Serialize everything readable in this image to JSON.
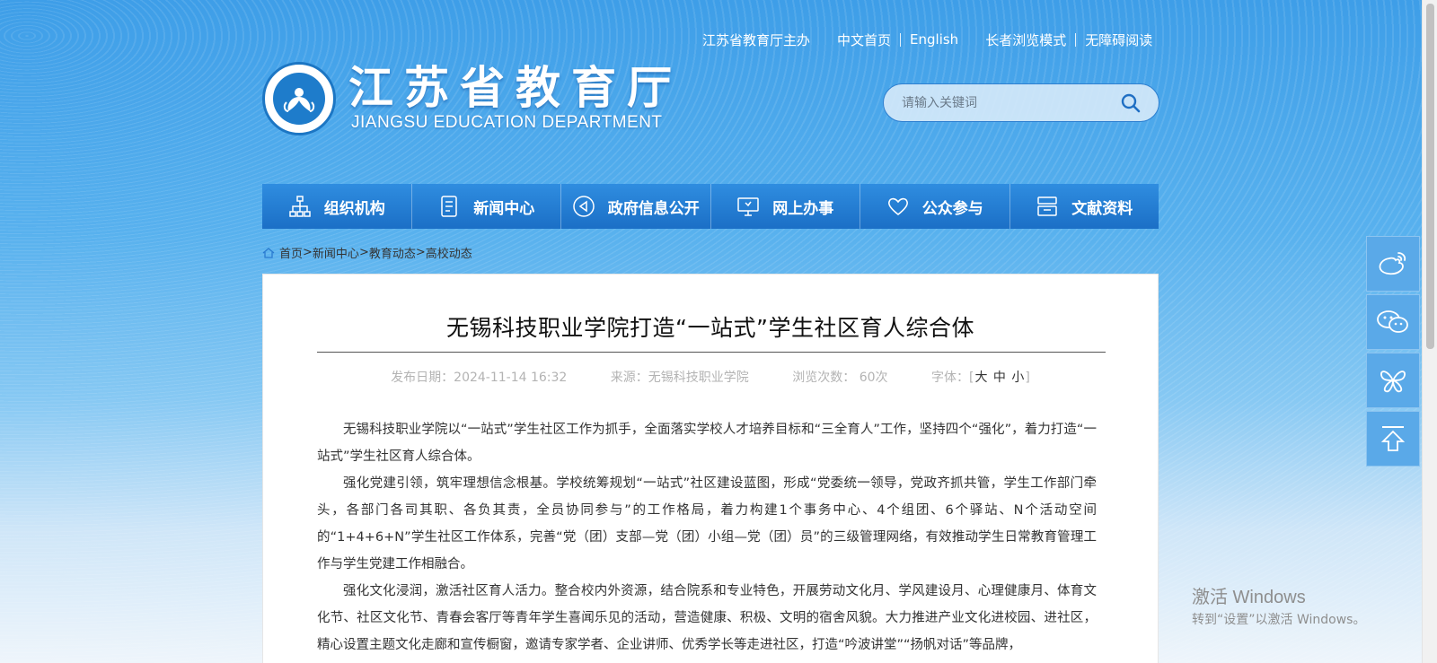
{
  "top_links": {
    "sponsor": "江苏省教育厅主办",
    "chinese_home": "中文首页",
    "english": "English",
    "elder_mode": "长者浏览模式",
    "accessible": "无障碍阅读"
  },
  "logo": {
    "title": "江苏省教育厅",
    "subtitle": "JIANGSU EDUCATION DEPARTMENT"
  },
  "search": {
    "placeholder": "请输入关键词"
  },
  "nav": [
    {
      "label": "组织机构",
      "icon": "org-chart-icon"
    },
    {
      "label": "新闻中心",
      "icon": "document-icon"
    },
    {
      "label": "政府信息公开",
      "icon": "speaker-icon"
    },
    {
      "label": "网上办事",
      "icon": "monitor-icon"
    },
    {
      "label": "公众参与",
      "icon": "heart-icon"
    },
    {
      "label": "文献资料",
      "icon": "archive-icon"
    }
  ],
  "breadcrumb": {
    "home": "首页",
    "c1": "新闻中心",
    "c2": "教育动态",
    "c3": "高校动态",
    "sep": ">"
  },
  "article": {
    "title": "无锡科技职业学院打造“一站式”学生社区育人综合体",
    "date_label": "发布日期：2024-11-14 16:32",
    "source_label": "来源：无锡科技职业学院",
    "views_label": "浏览次数：  60次",
    "font_label": "字体：[",
    "font_large": "大",
    "font_medium": "中",
    "font_small": "小",
    "font_close": "]",
    "paragraphs": [
      "无锡科技职业学院以“一站式”学生社区工作为抓手，全面落实学校人才培养目标和“三全育人”工作，坚持四个“强化”，着力打造“一站式”学生社区育人综合体。",
      "强化党建引领，筑牢理想信念根基。学校统筹规划“一站式”社区建设蓝图，形成“党委统一领导，党政齐抓共管，学生工作部门牵头，各部门各司其职、各负其责，全员协同参与”的工作格局，着力构建1个事务中心、4个组团、6个驿站、N个活动空间的“1+4+6+N”学生社区工作体系，完善“党（团）支部—党（团）小组—党（团）员”的三级管理网络，有效推动学生日常教育管理工作与学生党建工作相融合。",
      "强化文化浸润，激活社区育人活力。整合校内外资源，结合院系和专业特色，开展劳动文化月、学风建设月、心理健康月、体育文化节、社区文化节、青春会客厅等青年学生喜闻乐见的活动，营造健康、积极、文明的宿舍风貌。大力推进产业文化进校园、进社区，精心设置主题文化走廊和宣传橱窗，邀请专家学者、企业讲师、优秀学长等走进社区，打造“吟波讲堂”“扬帆对话”等品牌，"
    ]
  },
  "side_tools": [
    {
      "icon": "weibo-icon"
    },
    {
      "icon": "wechat-icon"
    },
    {
      "icon": "butterfly-icon"
    },
    {
      "icon": "back-to-top-icon"
    }
  ],
  "watermark": {
    "line1": "激活 Windows",
    "line2": "转到“设置”以激活 Windows。"
  }
}
